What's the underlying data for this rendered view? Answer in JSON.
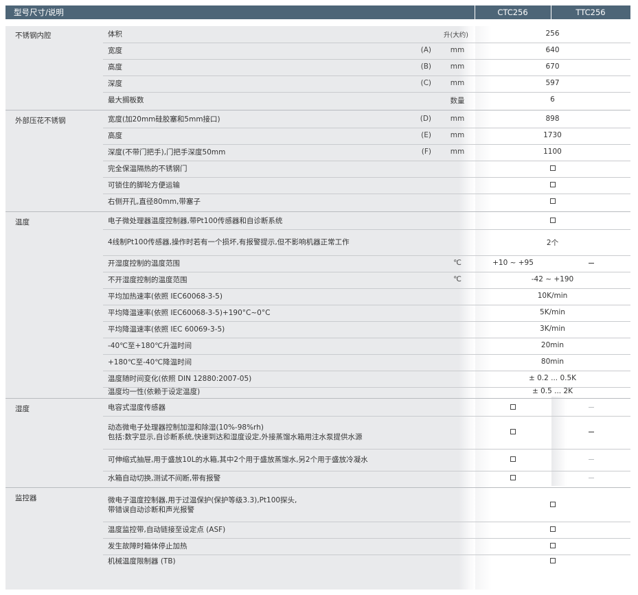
{
  "header": {
    "title": "型号尺寸/说明",
    "models": [
      "CTC256",
      "TTC256"
    ]
  },
  "sections": [
    {
      "label": "不锈钢内腔",
      "rows": [
        {
          "desc": [
            "体积"
          ],
          "mark": "",
          "unit": "升(大约)",
          "value": "256"
        },
        {
          "desc": [
            "宽度"
          ],
          "mark": "(A)",
          "unit": "mm",
          "value": "640"
        },
        {
          "desc": [
            "高度"
          ],
          "mark": "(B)",
          "unit": "mm",
          "value": "670"
        },
        {
          "desc": [
            "深度"
          ],
          "mark": "(C)",
          "unit": "mm",
          "value": "597"
        },
        {
          "desc": [
            "最大搁板数"
          ],
          "mark": "",
          "unit": "数量",
          "value": "6"
        }
      ]
    },
    {
      "label": "外部压花不锈钢",
      "rows": [
        {
          "desc": [
            "宽度(加20mm硅胶塞和5mm接口)"
          ],
          "mark": "(D)",
          "unit": "mm",
          "value": "898"
        },
        {
          "desc": [
            "高度"
          ],
          "mark": "(E)",
          "unit": "mm",
          "value": "1730"
        },
        {
          "desc": [
            "深度(不带门把手),门把手深度50mm"
          ],
          "mark": "(F)",
          "unit": "mm",
          "value": "1100"
        },
        {
          "desc": [
            "完全保温隔热的不锈钢门"
          ],
          "mark": "",
          "unit": "",
          "value": "□"
        },
        {
          "desc": [
            "可锁住的脚轮方便运输"
          ],
          "mark": "",
          "unit": "",
          "value": "□"
        },
        {
          "desc": [
            "右侧开孔,直径80mm,带塞子"
          ],
          "mark": "",
          "unit": "",
          "value": "□"
        }
      ]
    },
    {
      "label": "温度",
      "rows": [
        {
          "desc": [
            "电子微处理器温度控制器,带Pt100传感器和自诊断系统"
          ],
          "mark": "",
          "unit": "",
          "value": "□"
        },
        {
          "desc": [
            "4线制Pt100传感器,操作时若有一个损坏,有报警提示,但不影响机器正常工作"
          ],
          "mark": "",
          "unit": "",
          "value": "2个"
        },
        {
          "desc": [
            "开湿度控制的温度范围"
          ],
          "mark": "",
          "unit": "℃",
          "value_ctc": "+10 ~ +95",
          "value_ttc": "–"
        },
        {
          "desc": [
            "不开湿度控制的温度范围"
          ],
          "mark": "",
          "unit": "℃",
          "value": "-42 ~ +190"
        },
        {
          "desc": [
            "平均加热速率(依照 IEC60068-3-5)"
          ],
          "mark": "",
          "unit": "",
          "value": "10K/min"
        },
        {
          "desc": [
            "平均降温速率(依照 IEC60068-3-5)+190°C~0°C"
          ],
          "mark": "",
          "unit": "",
          "value": "5K/min"
        },
        {
          "desc": [
            "平均降温速率(依照 IEC 60069-3-5)"
          ],
          "mark": "",
          "unit": "",
          "value": "3K/min"
        },
        {
          "desc": [
            "-40℃至+180℃升温时间"
          ],
          "mark": "",
          "unit": "",
          "value": "20min"
        },
        {
          "desc": [
            "+180℃至-40℃降温时间"
          ],
          "mark": "",
          "unit": "",
          "value": "80min"
        },
        {
          "desc": [
            "温度随时间变化(依照 DIN 12880:2007-05)"
          ],
          "mark": "",
          "unit": "",
          "value": "± 0.2 ... 0.5K"
        },
        {
          "desc": [
            "温度均一性(依赖于设定温度)"
          ],
          "mark": "",
          "unit": "",
          "value": "± 0.5 ... 2K"
        }
      ]
    },
    {
      "label": "湿度",
      "rows": [
        {
          "desc": [
            "电容式湿度传感器"
          ],
          "mark": "",
          "unit": "",
          "value_ctc": "□",
          "value_ttc": "–"
        },
        {
          "desc": [
            "动态微电子处理器控制加湿和除湿(10%-98%rh)",
            "包括:数字显示,自诊断系统,快速到达和湿度设定,外接蒸馏水箱用注水泵提供水源"
          ],
          "mark": "",
          "unit": "",
          "value_ctc": "□",
          "value_ttc": "–"
        },
        {
          "desc": [
            "可伸缩式抽屉,用于盛放10L的水箱,其中2个用于盛放蒸馏水,另2个用于盛放冷凝水"
          ],
          "mark": "",
          "unit": "",
          "value_ctc": "□",
          "value_ttc": "–"
        },
        {
          "desc": [
            "水箱自动切换,测试不间断,带有报警"
          ],
          "mark": "",
          "unit": "",
          "value_ctc": "□",
          "value_ttc": "–"
        }
      ]
    },
    {
      "label": "监控器",
      "rows": [
        {
          "desc": [
            "微电子温度控制器,用于过温保护(保护等级3.3),Pt100探头,",
            "带错误自动诊断和声光报警"
          ],
          "mark": "",
          "unit": "",
          "value": "□"
        },
        {
          "desc": [
            "温度监控带,自动链接至设定点 (ASF)"
          ],
          "mark": "",
          "unit": "",
          "value": "□"
        },
        {
          "desc": [
            "发生故障时箱体停止加热"
          ],
          "mark": "",
          "unit": "",
          "value": "□"
        },
        {
          "desc": [
            "机械温度限制器 (TB)"
          ],
          "mark": "",
          "unit": "",
          "value": "□"
        }
      ]
    }
  ]
}
